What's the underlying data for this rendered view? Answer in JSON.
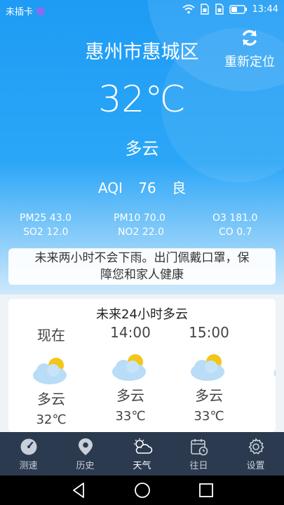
{
  "status_bar": {
    "carrier": "未插卡",
    "time": "13:44"
  },
  "header": {
    "city": "惠州市惠城区",
    "relocate_label": "重新定位"
  },
  "current": {
    "temperature": "32℃",
    "condition": "多云",
    "aqi_label": "AQI",
    "aqi_value": "76",
    "aqi_level": "良"
  },
  "pollutants": {
    "pm25": "PM25  43.0",
    "pm10": "PM10  70.0",
    "o3": "O3  181.0",
    "so2": "SO2  12.0",
    "no2": "NO2  22.0",
    "co": "CO  0.7"
  },
  "advice": {
    "line1": "未来两小时不会下雨。出门佩戴口罩，保",
    "line2": "障您和家人健康"
  },
  "forecast": {
    "title": "未来24小时多云",
    "hours": [
      {
        "time": "现在",
        "condition": "多云",
        "temp": "32℃",
        "icon": "partly-cloudy-icon"
      },
      {
        "time": "14:00",
        "condition": "多云",
        "temp": "33℃",
        "icon": "partly-cloudy-icon"
      },
      {
        "time": "15:00",
        "condition": "多云",
        "temp": "33℃",
        "icon": "partly-cloudy-icon"
      }
    ]
  },
  "tabs": [
    {
      "label": "测速",
      "icon": "speedometer-icon",
      "active": false
    },
    {
      "label": "历史",
      "icon": "location-pin-icon",
      "active": false
    },
    {
      "label": "天气",
      "icon": "weather-cloud-icon",
      "active": true
    },
    {
      "label": "往日",
      "icon": "calendar-clock-icon",
      "active": false
    },
    {
      "label": "设置",
      "icon": "gear-icon",
      "active": false
    }
  ],
  "colors": {
    "hero_blue": "#1e9bf4",
    "tabbar_bg": "#2b3a4f",
    "sun_yellow": "#f5c518",
    "cloud_blue": "#b9dcf7"
  }
}
